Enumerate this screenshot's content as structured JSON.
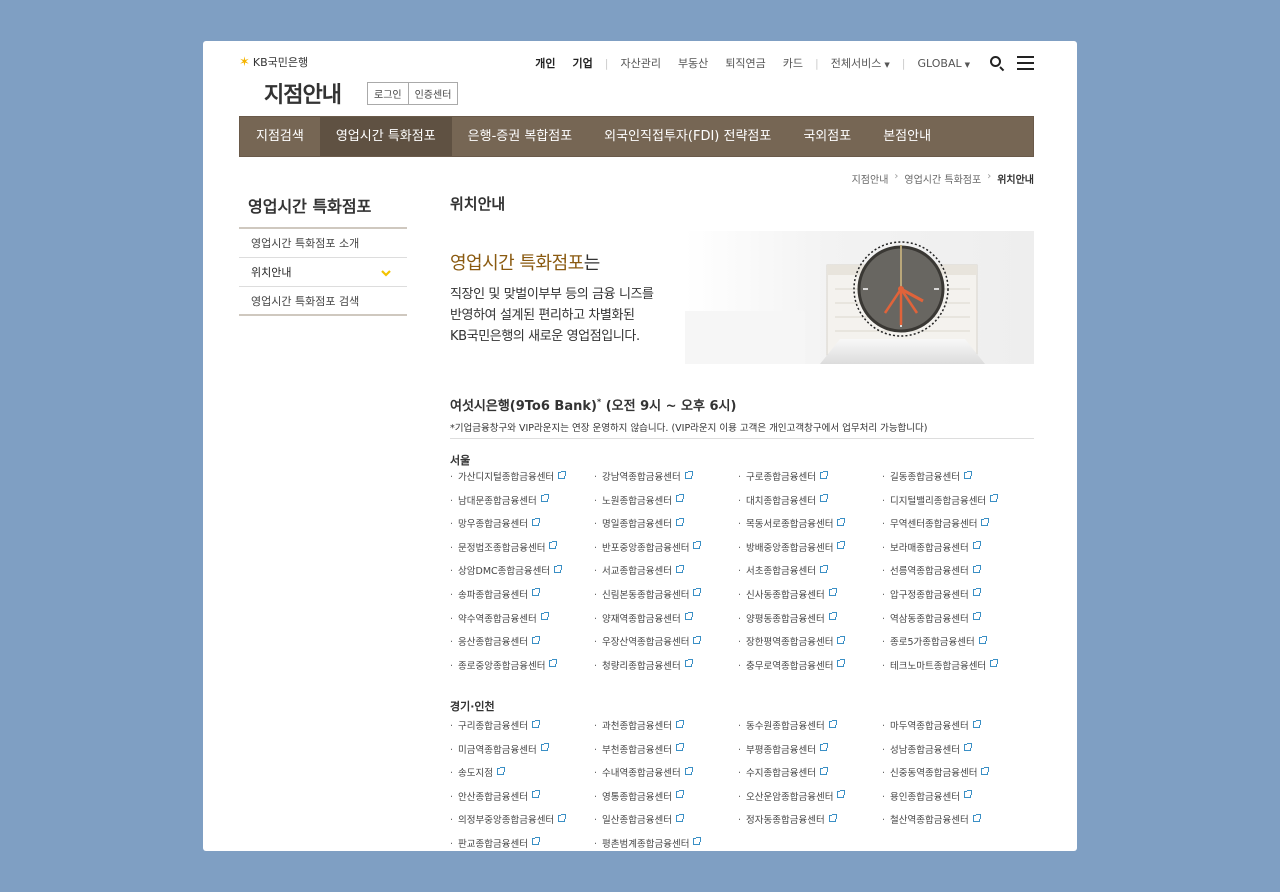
{
  "header": {
    "logo_text": "KB국민은행",
    "site_title": "지점안내",
    "login_label": "로그인",
    "cert_label": "인증센터",
    "gnb": [
      "개인",
      "기업",
      "자산관리",
      "부동산",
      "퇴직연금",
      "카드",
      "전체서비스",
      "GLOBAL"
    ]
  },
  "nav": {
    "items": [
      "지점검색",
      "영업시간 특화점포",
      "은행-증권 복합점포",
      "외국인직접투자(FDI) 전략점포",
      "국외점포",
      "본점안내"
    ]
  },
  "breadcrumb": [
    "지점안내",
    "영업시간 특화점포",
    "위치안내"
  ],
  "sidebar": {
    "title": "영업시간 특화점포",
    "items": [
      "영업시간 특화점포 소개",
      "위치안내",
      "영업시간 특화점포 검색"
    ]
  },
  "content": {
    "page_title": "위치안내",
    "intro_head": "영업시간 특화점포",
    "intro_head_suffix": "는",
    "intro_lines": [
      "직장인 및 맞벌이부부 등의 금융 니즈를",
      "반영하여 설계된 편리하고 차별화된",
      "KB국민은행의 새로운 영업점입니다."
    ],
    "sched_title": "여섯시은행(9To6 Bank)",
    "sched_mark": "*",
    "sched_hours": "(오전 9시 ~ 오후 6시)",
    "sched_note": "*기업금융창구와 VIP라운지는 연장 운영하지 않습니다. (VIP라운지 이용 고객은 개인고객창구에서 업무처리 가능합니다)"
  },
  "regions": [
    {
      "name": "서울",
      "branches": [
        "가산디지털종합금융센터",
        "강남역종합금융센터",
        "구로종합금융센터",
        "길동종합금융센터",
        "남대문종합금융센터",
        "노원종합금융센터",
        "대치종합금융센터",
        "디지털밸리종합금융센터",
        "망우종합금융센터",
        "명일종합금융센터",
        "목동서로종합금융센터",
        "무역센터종합금융센터",
        "문정법조종합금융센터",
        "반포중앙종합금융센터",
        "방배중앙종합금융센터",
        "보라매종합금융센터",
        "상암DMC종합금융센터",
        "서교종합금융센터",
        "서초종합금융센터",
        "선릉역종합금융센터",
        "송파종합금융센터",
        "신림본동종합금융센터",
        "신사동종합금융센터",
        "압구정종합금융센터",
        "약수역종합금융센터",
        "양재역종합금융센터",
        "양평동종합금융센터",
        "역삼동종합금융센터",
        "응산종합금융센터",
        "우장산역종합금융센터",
        "장한평역종합금융센터",
        "종로5가종합금융센터",
        "종로중앙종합금융센터",
        "청량리종합금융센터",
        "충무로역종합금융센터",
        "테크노마트종합금융센터"
      ]
    },
    {
      "name": "경기·인천",
      "branches": [
        "구리종합금융센터",
        "과천종합금융센터",
        "동수원종합금융센터",
        "마두역종합금융센터",
        "미금역종합금융센터",
        "부천종합금융센터",
        "부평종합금융센터",
        "성남종합금융센터",
        "송도지점",
        "수내역종합금융센터",
        "수지종합금융센터",
        "신중동역종합금융센터",
        "안산종합금융센터",
        "영통종합금융센터",
        "오산운암종합금융센터",
        "용인종합금융센터",
        "의정부중앙종합금융센터",
        "일산종합금융센터",
        "정자동종합금융센터",
        "철산역종합금융센터",
        "판교종합금융센터",
        "평촌범계종합금융센터"
      ]
    }
  ],
  "colors": {
    "nav_bg": "#766654",
    "nav_active": "#5f5142",
    "accent_gold": "#8a5a10",
    "chevron": "#f2c200",
    "link_icon": "#3a8fc5"
  }
}
